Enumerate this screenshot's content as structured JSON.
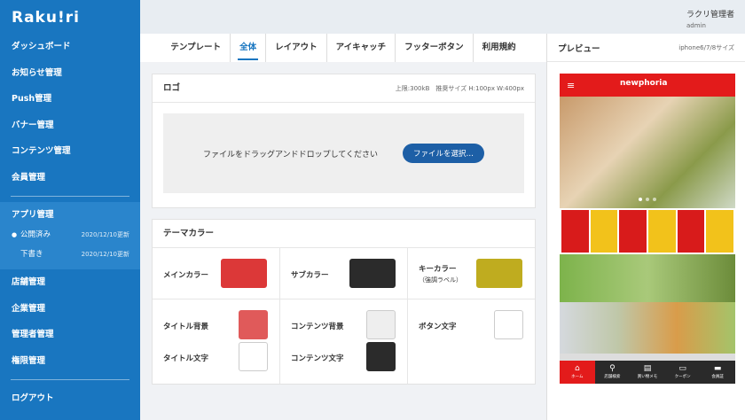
{
  "app": {
    "logo": "Raku!ri"
  },
  "header": {
    "user_name": "ラクリ管理者",
    "user_role": "admin"
  },
  "sidebar": {
    "items_top": [
      "ダッシュボード",
      "お知らせ管理",
      "Push管理",
      "バナー管理",
      "コンテンツ管理",
      "会員管理"
    ],
    "group": {
      "title": "アプリ管理",
      "subs": [
        {
          "label": "公開済み",
          "meta": "2020/12/10更新",
          "active": true
        },
        {
          "label": "下書き",
          "meta": "2020/12/10更新",
          "active": false
        }
      ]
    },
    "items_bottom": [
      "店舗管理",
      "企業管理",
      "管理者管理",
      "権限管理"
    ],
    "logout": "ログアウト"
  },
  "tabs": [
    "テンプレート",
    "全体",
    "レイアウト",
    "アイキャッチ",
    "フッターボタン",
    "利用規約"
  ],
  "active_tab": 1,
  "logo_card": {
    "title": "ロゴ",
    "spec": "上限:300kB　推奨サイズ H:100px W:400px",
    "drop_text": "ファイルをドラッグアンドドロップしてください",
    "button": "ファイルを選択…"
  },
  "theme_card": {
    "title": "テーマカラー",
    "colors": {
      "main": {
        "label": "メインカラー",
        "color": "#dc3838"
      },
      "sub": {
        "label": "サブカラー",
        "color": "#2b2b2b"
      },
      "key": {
        "label": "キーカラー",
        "note": "（強調ラベル）",
        "color": "#bfac1f"
      },
      "title_bg": {
        "label": "タイトル背景",
        "color": "#e05a5a"
      },
      "content_bg": {
        "label": "コンテンツ背景",
        "color": "#eeeeee"
      },
      "button_text": {
        "label": "ボタン文字",
        "color": "#ffffff"
      },
      "title_text": {
        "label": "タイトル文字",
        "color": "#ffffff"
      },
      "content_text": {
        "label": "コンテンツ文字",
        "color": "#2b2b2b"
      }
    }
  },
  "preview": {
    "title": "プレビュー",
    "device": "iphone6/7/8サイズ",
    "brand": "newphoria",
    "bottom_nav": [
      "ホーム",
      "店舗検索",
      "買い物メモ",
      "クーポン",
      "会員証"
    ]
  }
}
